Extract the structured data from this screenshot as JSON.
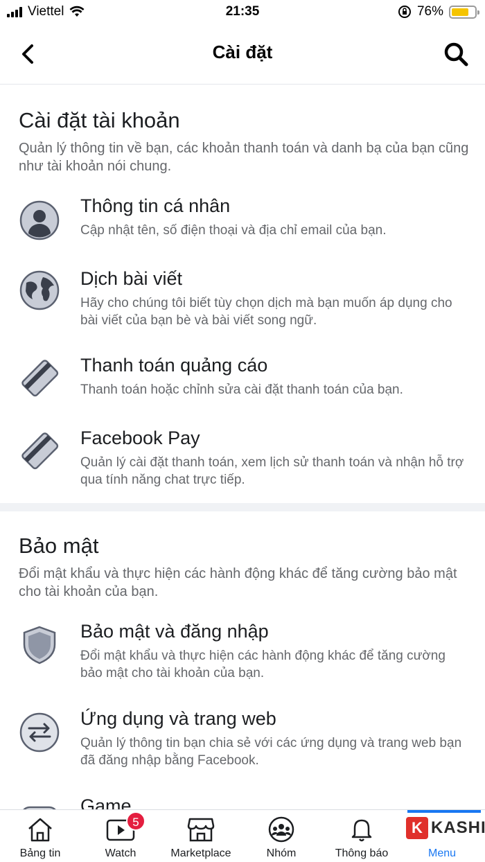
{
  "status_bar": {
    "carrier": "Viettel",
    "time": "21:35",
    "battery": "76%",
    "battery_level": 0.76
  },
  "header": {
    "title": "Cài đặt"
  },
  "account_section": {
    "title": "Cài đặt tài khoản",
    "description": "Quản lý thông tin về bạn, các khoản thanh toán và danh bạ của bạn cũng như tài khoản nói chung.",
    "items": [
      {
        "icon": "person-icon",
        "title": "Thông tin cá nhân",
        "subtitle": "Cập nhật tên, số điện thoại và địa chỉ email của bạn."
      },
      {
        "icon": "globe-icon",
        "title": "Dịch bài viết",
        "subtitle": "Hãy cho chúng tôi biết tùy chọn dịch mà bạn muốn áp dụng cho bài viết của bạn bè và bài viết song ngữ."
      },
      {
        "icon": "credit-card-icon",
        "title": "Thanh toán quảng cáo",
        "subtitle": "Thanh toán hoặc chỉnh sửa cài đặt thanh toán của bạn."
      },
      {
        "icon": "credit-card-icon",
        "title": "Facebook Pay",
        "subtitle": "Quản lý cài đặt thanh toán, xem lịch sử thanh toán và nhận hỗ trợ qua tính năng chat trực tiếp."
      }
    ]
  },
  "security_section": {
    "title": "Bảo mật",
    "description": "Đổi mật khẩu và thực hiện các hành động khác để tăng cường bảo mật cho tài khoản của bạn.",
    "items": [
      {
        "icon": "shield-icon",
        "title": "Bảo mật và đăng nhập",
        "subtitle": "Đổi mật khẩu và thực hiện các hành động khác để tăng cường bảo mật cho tài khoản của bạn."
      },
      {
        "icon": "swap-arrows-icon",
        "title": "Ứng dụng và trang web",
        "subtitle": "Quản lý thông tin bạn chia sẻ với các ứng dụng và trang web bạn đã đăng nhập bằng Facebook."
      },
      {
        "icon": "game-icon",
        "title": "Game",
        "subtitle": ""
      }
    ]
  },
  "tabbar": {
    "tabs": [
      {
        "label": "Bảng tin",
        "icon": "home-icon"
      },
      {
        "label": "Watch",
        "icon": "watch-icon",
        "badge": "5"
      },
      {
        "label": "Marketplace",
        "icon": "marketplace-icon"
      },
      {
        "label": "Nhóm",
        "icon": "groups-icon"
      },
      {
        "label": "Thông báo",
        "icon": "bell-icon"
      },
      {
        "label": "Menu",
        "icon": "menu-icon"
      }
    ],
    "active_tab": "Menu",
    "watermark": "KASHI"
  },
  "colors": {
    "accent": "#1877f2",
    "badge": "#e41e3f",
    "secondary_text": "#65676b",
    "battery": "#f5c400"
  }
}
